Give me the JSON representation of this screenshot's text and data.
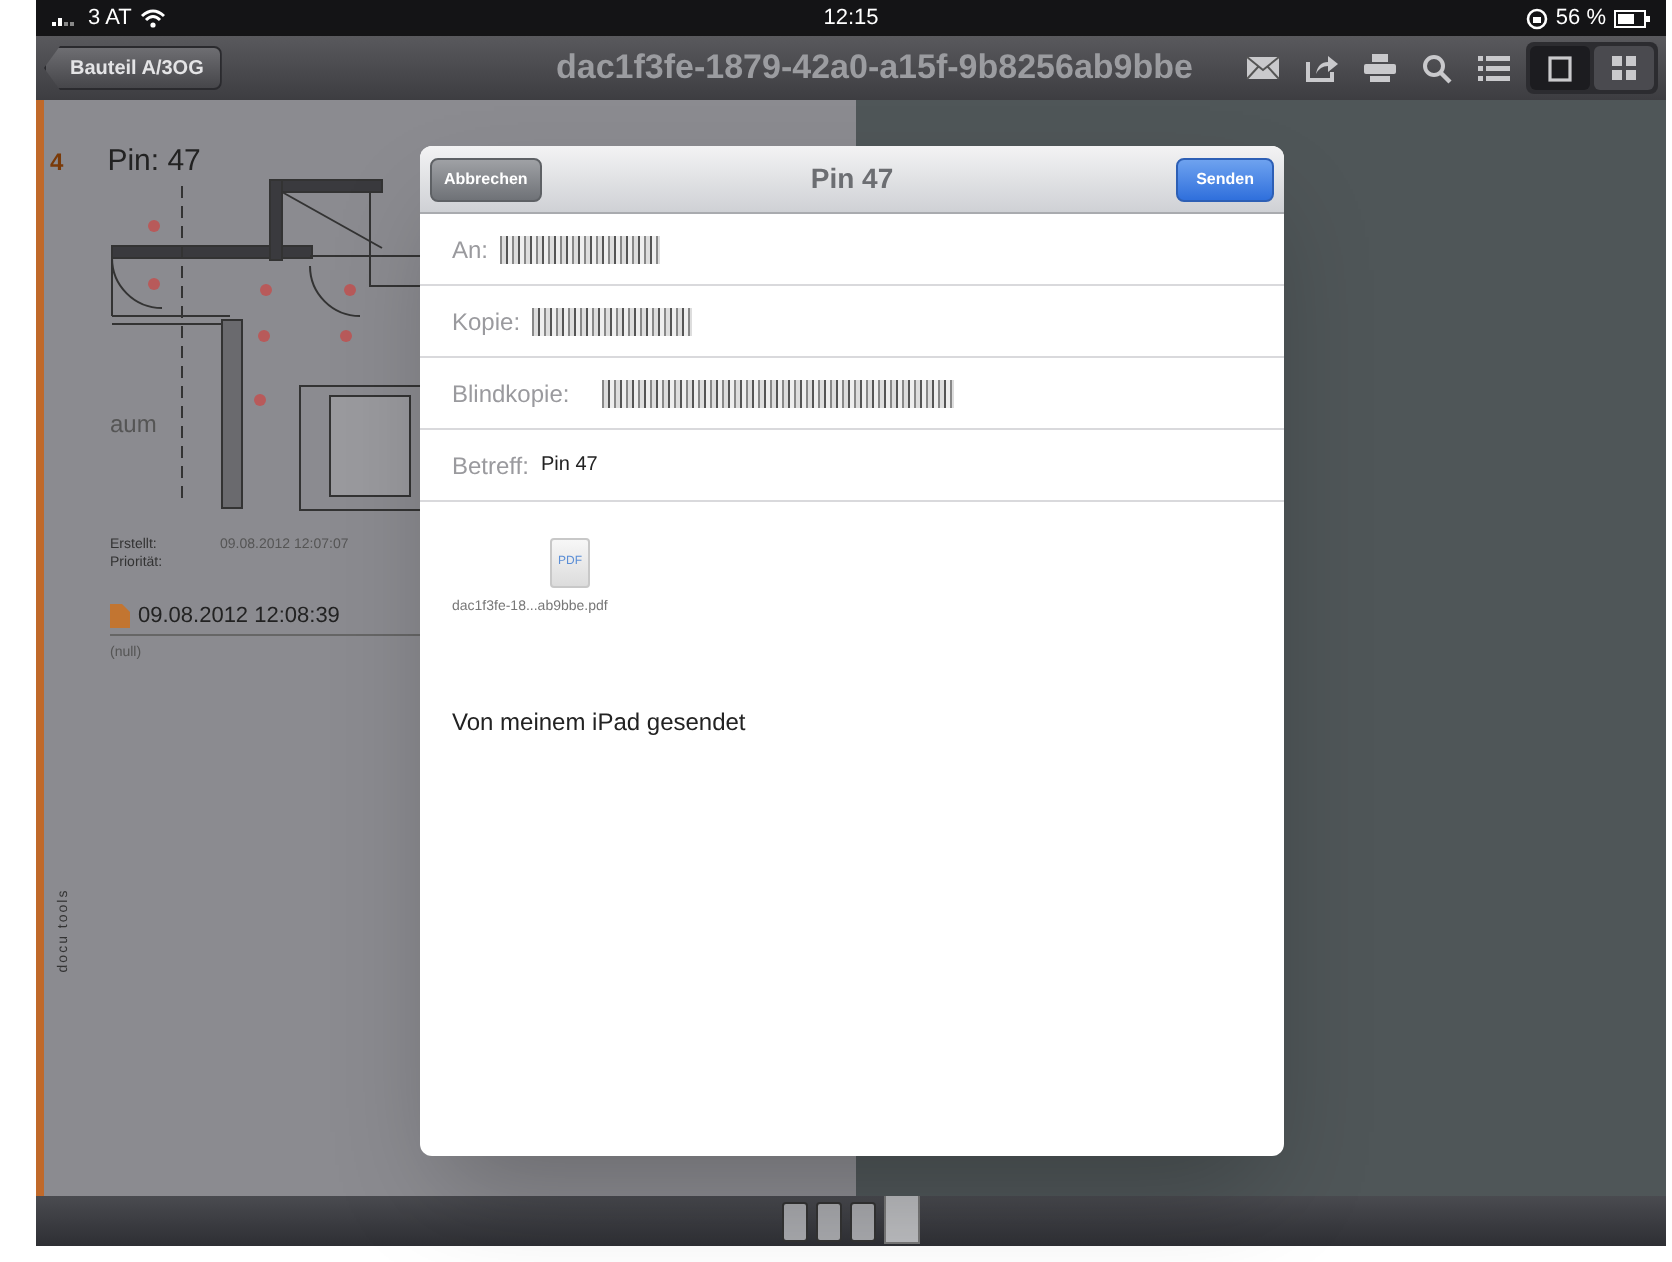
{
  "status_bar": {
    "carrier": "3 AT",
    "time": "12:15",
    "battery": "56 %"
  },
  "nav_bar": {
    "back": "Bauteil A/3OG",
    "title": "dac1f3fe-1879-42a0-a15f-9b8256ab9bbe",
    "view_buttons": [
      {
        "kind": "single",
        "selected": true
      },
      {
        "kind": "grid",
        "selected": false
      }
    ]
  },
  "pin_page": {
    "number": "4",
    "title": "Pin: 47",
    "plan_label": "aum",
    "created_label": "Erstellt:",
    "created": "09.08.2012 12:07:07",
    "priority_label": "Priorität:",
    "entry_date": "09.08.2012 12:08:39",
    "note": "(null)",
    "logo": "docu tools"
  },
  "mail": {
    "cancel": "Abbrechen",
    "title": "Pin 47",
    "send": "Senden",
    "fields": [
      {
        "label": "An:",
        "redacted": true
      },
      {
        "label": "Kopie:",
        "redacted": true
      },
      {
        "label": "Blindkopie:",
        "redacted": true
      },
      {
        "label": "Betreff:",
        "redacted": false,
        "value": "Pin 47"
      }
    ],
    "attachment": "dac1f3fe-18...ab9bbe.pdf",
    "attachment_type": "PDF",
    "body": "Von meinem iPad gesendet"
  },
  "page_strip": [
    {
      "selected": false
    },
    {
      "selected": false
    },
    {
      "selected": false
    },
    {
      "selected": true
    }
  ]
}
